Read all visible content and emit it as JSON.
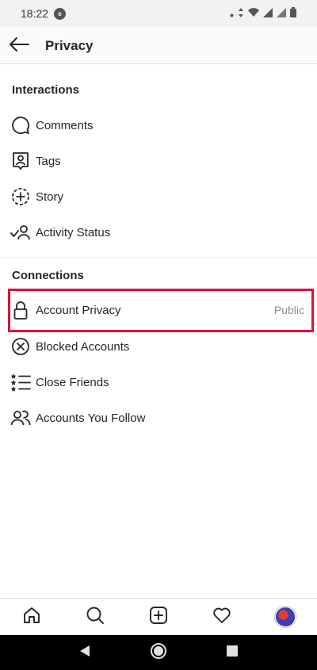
{
  "status_bar": {
    "time": "18:22",
    "app_icon_text": "e"
  },
  "header": {
    "title": "Privacy"
  },
  "sections": {
    "interactions": {
      "title": "Interactions",
      "items": [
        {
          "label": "Comments",
          "icon": "comment-icon"
        },
        {
          "label": "Tags",
          "icon": "tag-icon"
        },
        {
          "label": "Story",
          "icon": "story-icon"
        },
        {
          "label": "Activity Status",
          "icon": "activity-status-icon"
        }
      ]
    },
    "connections": {
      "title": "Connections",
      "items": [
        {
          "label": "Account Privacy",
          "value": "Public",
          "icon": "lock-icon"
        },
        {
          "label": "Blocked Accounts",
          "icon": "blocked-icon"
        },
        {
          "label": "Close Friends",
          "icon": "close-friends-icon"
        },
        {
          "label": "Accounts You Follow",
          "icon": "people-icon"
        }
      ]
    }
  },
  "bottom_nav": [
    "home-icon",
    "search-icon",
    "new-post-icon",
    "heart-icon",
    "profile-avatar"
  ],
  "colors": {
    "highlight": "#e0103a",
    "text": "#262626",
    "muted": "#8e8e8e"
  }
}
